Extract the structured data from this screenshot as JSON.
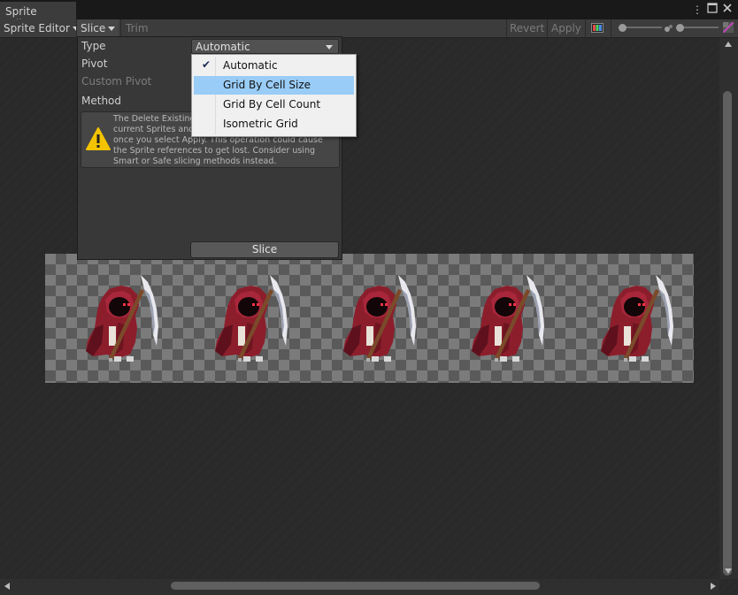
{
  "window": {
    "tab_title": "Sprite Editor",
    "more_icon": "more-vert-icon",
    "maximize_icon": "maximize-icon",
    "close_icon": "close-icon"
  },
  "toolbar": {
    "mode_label": "Sprite Editor",
    "slice_label": "Slice",
    "trim_label": "Trim",
    "revert_label": "Revert",
    "apply_label": "Apply",
    "rgb_icon": "color-channels-icon",
    "zoom_icon": "zoom-slider-icon",
    "mipmap_icon": "mipmap-icon",
    "alpha_icon": "alpha-icon"
  },
  "slice_panel": {
    "type_label": "Type",
    "type_value": "Automatic",
    "pivot_label": "Pivot",
    "custom_pivot_label": "Custom Pivot",
    "method_label": "Method",
    "warning_text_line1": "The Delete Existing",
    "warning_text_line2": "current Sprites and",
    "warning_text_line3": "once you select Apply. This operation could cause",
    "warning_text_line4": "the Sprite references to get lost. Consider using",
    "warning_text_line5": "Smart or Safe slicing methods instead.",
    "slice_button": "Slice",
    "warning_icon": "warning-icon"
  },
  "type_menu": {
    "items": [
      {
        "label": "Automatic",
        "checked": true
      },
      {
        "label": "Grid By Cell Size",
        "highlighted": true
      },
      {
        "label": "Grid By Cell Count"
      },
      {
        "label": "Isometric Grid"
      }
    ]
  },
  "sprite_sheet": {
    "frame_count": 5,
    "sprite_subject": "grim-reaper-sprite"
  },
  "colors": {
    "menu_highlight": "#99ccf7",
    "warning_yellow": "#f3c300"
  }
}
